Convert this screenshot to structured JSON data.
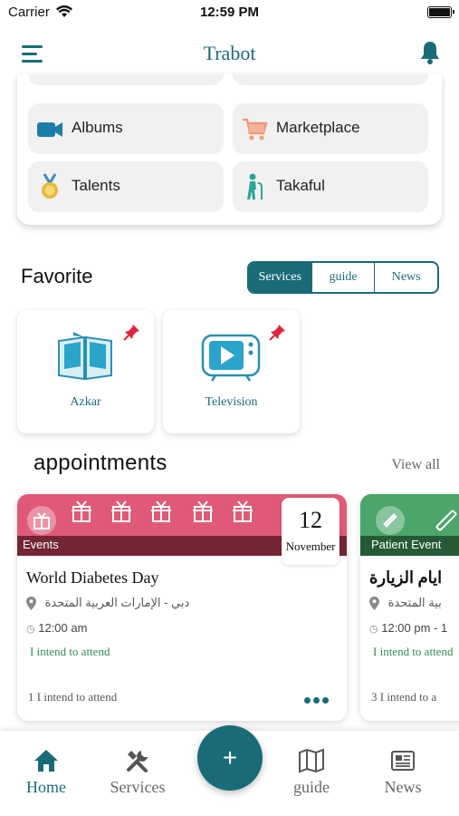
{
  "status_bar": {
    "carrier": "Carrier",
    "time": "12:59 PM"
  },
  "header": {
    "title": "Trabot"
  },
  "categories": [
    {
      "label": "Albums",
      "icon": "video-camera-icon"
    },
    {
      "label": "Marketplace",
      "icon": "shopping-cart-icon"
    },
    {
      "label": "Talents",
      "icon": "medal-icon"
    },
    {
      "label": "Takaful",
      "icon": "walking-cane-person-icon"
    }
  ],
  "favorite": {
    "title": "Favorite",
    "tabs": [
      "Services",
      "guide",
      "News"
    ],
    "selected_tab": "Services",
    "items": [
      {
        "label": "Azkar",
        "icon": "open-book-icon"
      },
      {
        "label": "Television",
        "icon": "television-icon"
      }
    ]
  },
  "appointments": {
    "title": "appointments",
    "view_all": "View all",
    "cards": [
      {
        "tag": "Events",
        "day": "12",
        "month": "November",
        "name": "World Diabetes Day",
        "location": "دبي - الإمارات العربية المتحدة",
        "time": "12:00 am",
        "intend_button": "I intend to attend",
        "count": "1",
        "count_label": "I intend to attend",
        "banner_color": "#e05a77"
      },
      {
        "tag": "Patient Event",
        "name": "ايام الزيارة",
        "location": "بية المتحدة",
        "time": "12:00 pm - 1",
        "intend_button": "I intend to attend",
        "count": "3",
        "count_label": "I intend to a",
        "banner_color": "#4aa66a"
      }
    ]
  },
  "tab_bar": {
    "items": [
      {
        "label": "Home",
        "icon": "home-icon",
        "active": true
      },
      {
        "label": "Services",
        "icon": "tools-icon"
      },
      {
        "label": "guide",
        "icon": "map-icon"
      },
      {
        "label": "News",
        "icon": "newspaper-icon"
      }
    ],
    "fab_label": "+"
  },
  "colors": {
    "primary": "#1a6b78",
    "events_banner": "#e05a77",
    "patient_banner": "#4aa66a",
    "pin": "#e0263d"
  }
}
